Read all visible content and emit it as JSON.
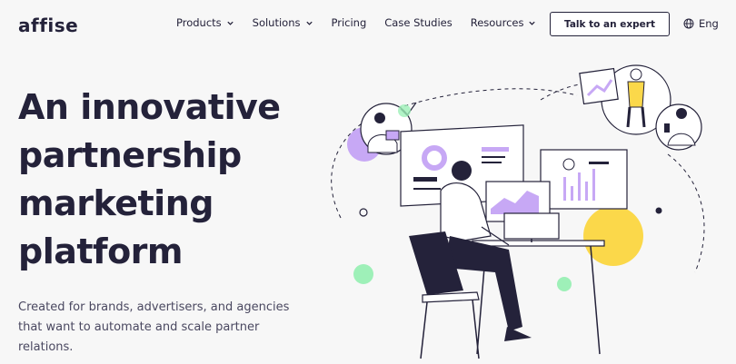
{
  "brand": {
    "logo_text": "affise"
  },
  "nav": {
    "items": [
      {
        "label": "Products",
        "has_dropdown": true
      },
      {
        "label": "Solutions",
        "has_dropdown": true
      },
      {
        "label": "Pricing",
        "has_dropdown": false
      },
      {
        "label": "Case Studies",
        "has_dropdown": false
      },
      {
        "label": "Resources",
        "has_dropdown": true
      }
    ],
    "cta_label": "Talk to an expert",
    "language": {
      "label": "Eng",
      "icon": "globe-icon"
    }
  },
  "hero": {
    "title_lines": [
      "An innovative",
      "partnership",
      "marketing",
      "platform"
    ],
    "subtitle": "Created for brands, advertisers, and agencies that want to automate and scale partner relations."
  },
  "colors": {
    "text": "#24223a",
    "background": "#f7f7f7",
    "purple": "#c7a8f5",
    "yellow": "#fbd84a",
    "green": "#9ef0b8"
  }
}
